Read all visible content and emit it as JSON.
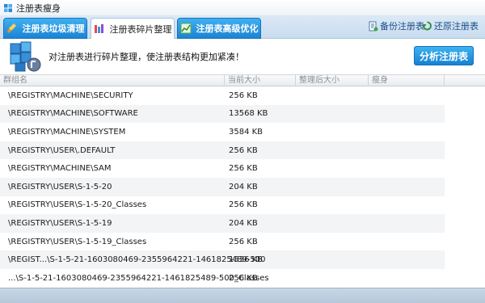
{
  "window": {
    "title": "注册表瘦身"
  },
  "tabs": [
    {
      "label": "注册表垃圾清理",
      "active": false
    },
    {
      "label": "注册表碎片整理",
      "active": true
    },
    {
      "label": "注册表高级优化",
      "active": false
    }
  ],
  "toolbar": {
    "backup_label": "备份注册表",
    "restore_label": "还原注册表"
  },
  "info": {
    "message": "对注册表进行碎片整理，使注册表结构更加紧凑！",
    "analyze_label": "分析注册表"
  },
  "table": {
    "headers": [
      "群组名",
      "当前大小",
      "整理后大小",
      "瘦身"
    ],
    "rows": [
      {
        "name": "\\REGISTRY\\MACHINE\\SECURITY",
        "size": "256 KB"
      },
      {
        "name": "\\REGISTRY\\MACHINE\\SOFTWARE",
        "size": "13568 KB"
      },
      {
        "name": "\\REGISTRY\\MACHINE\\SYSTEM",
        "size": "3584 KB"
      },
      {
        "name": "\\REGISTRY\\USER\\.DEFAULT",
        "size": "256 KB"
      },
      {
        "name": "\\REGISTRY\\MACHINE\\SAM",
        "size": "256 KB"
      },
      {
        "name": "\\REGISTRY\\USER\\S-1-5-20",
        "size": "204 KB"
      },
      {
        "name": "\\REGISTRY\\USER\\S-1-5-20_Classes",
        "size": "256 KB"
      },
      {
        "name": "\\REGISTRY\\USER\\S-1-5-19",
        "size": "204 KB"
      },
      {
        "name": "\\REGISTRY\\USER\\S-1-5-19_Classes",
        "size": "256 KB"
      },
      {
        "name": "\\REGIST...\\S-1-5-21-1603080469-2355964221-1461825489-500",
        "size": "1536 KB"
      },
      {
        "name": "...\\S-1-5-21-1603080469-2355964221-1461825489-500_Classes",
        "size": "256 KB"
      }
    ]
  },
  "colors": {
    "tab_blue": "#1b83d4",
    "accent_button": "#1780d2",
    "link": "#1a4e86"
  },
  "icons": {
    "app": "registry-cube-icon",
    "tab_clean": "broom-icon",
    "tab_defrag": "defrag-bars-icon",
    "tab_optimize": "chart-icon",
    "backup": "backup-document-icon",
    "restore": "restore-arrow-icon",
    "info": "registry-cubes-icon"
  }
}
